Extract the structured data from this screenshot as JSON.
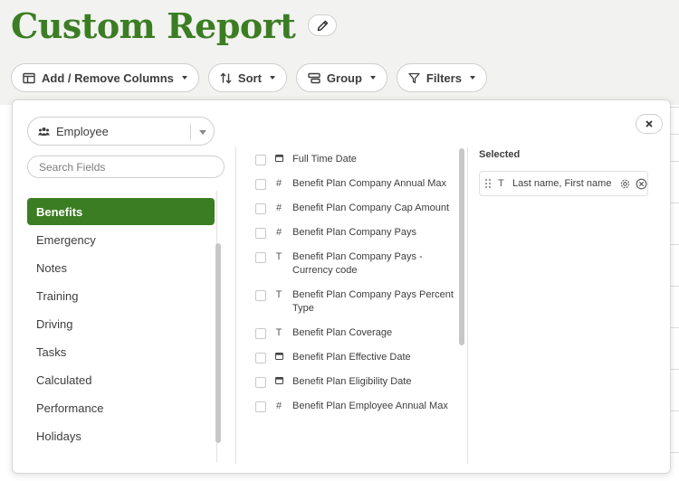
{
  "page": {
    "title": "Custom Report"
  },
  "toolbar": {
    "columns_label": "Add / Remove Columns",
    "sort_label": "Sort",
    "group_label": "Group",
    "filters_label": "Filters"
  },
  "picker": {
    "entity": "Employee",
    "search_placeholder": "Search Fields",
    "categories": [
      {
        "label": "Benefits",
        "active": true
      },
      {
        "label": "Emergency",
        "active": false
      },
      {
        "label": "Notes",
        "active": false
      },
      {
        "label": "Training",
        "active": false
      },
      {
        "label": "Driving",
        "active": false
      },
      {
        "label": "Tasks",
        "active": false
      },
      {
        "label": "Calculated",
        "active": false
      },
      {
        "label": "Performance",
        "active": false
      },
      {
        "label": "Holidays",
        "active": false
      }
    ],
    "fields": [
      {
        "type": "date",
        "label": "Full Time Date"
      },
      {
        "type": "number",
        "label": "Benefit Plan Company Annual Max"
      },
      {
        "type": "number",
        "label": "Benefit Plan Company Cap Amount"
      },
      {
        "type": "number",
        "label": "Benefit Plan Company Pays"
      },
      {
        "type": "text",
        "label": "Benefit Plan Company Pays - Currency code"
      },
      {
        "type": "text",
        "label": "Benefit Plan Company Pays Percent Type"
      },
      {
        "type": "text",
        "label": "Benefit Plan Coverage"
      },
      {
        "type": "date",
        "label": "Benefit Plan Effective Date"
      },
      {
        "type": "date",
        "label": "Benefit Plan Eligibility Date"
      },
      {
        "type": "number",
        "label": "Benefit Plan Employee Annual Max"
      }
    ],
    "selected_title": "Selected",
    "selected": [
      {
        "type": "text",
        "label": "Last name, First name"
      }
    ]
  },
  "colors": {
    "accent": "#3b7d23"
  }
}
